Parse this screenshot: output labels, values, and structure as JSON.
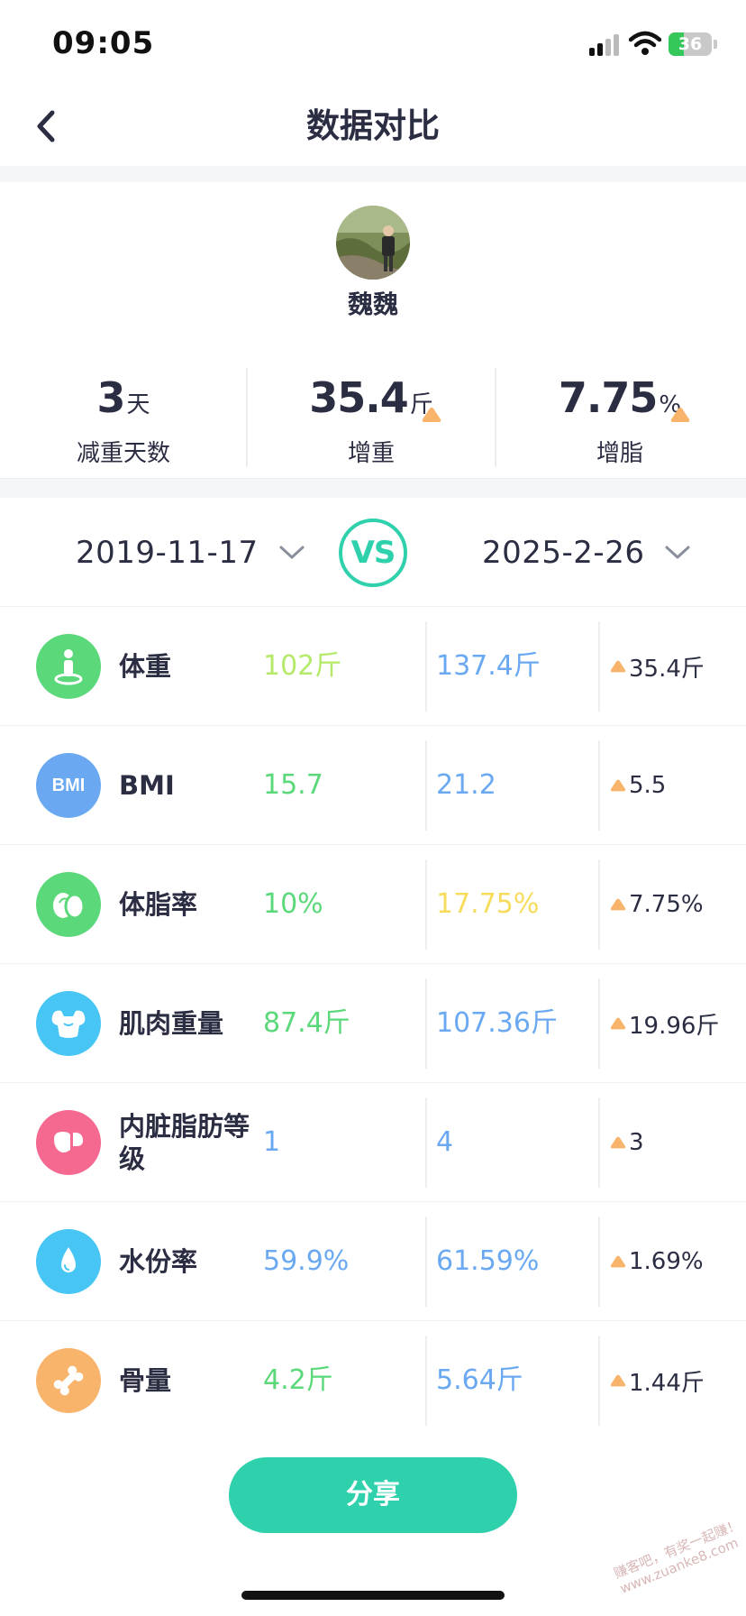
{
  "status_bar": {
    "time": "09:05",
    "battery": "36",
    "battery_level": 0.36
  },
  "nav": {
    "title": "数据对比"
  },
  "user": {
    "name": "魏魏"
  },
  "stats": [
    {
      "value": "3",
      "unit": "天",
      "label": "减重天数",
      "trend": ""
    },
    {
      "value": "35.4",
      "unit": "斤",
      "label": "增重",
      "trend": "up"
    },
    {
      "value": "7.75",
      "unit": "%",
      "label": "增脂",
      "trend": "up"
    }
  ],
  "compare": {
    "date_left": "2019-11-17",
    "vs_label": "VS",
    "date_right": "2025-2-26"
  },
  "metrics": [
    {
      "label": "体重",
      "icon": "body-weight-icon",
      "icon_color": "#5bd87a",
      "v1": "102斤",
      "v1_color": "#b5e96a",
      "v2": "137.4斤",
      "v2_color": "#6aa9f2",
      "diff": "35.4斤"
    },
    {
      "label": "BMI",
      "icon": "bmi-icon",
      "icon_text": "BMI",
      "icon_color": "#6aa9f2",
      "v1": "15.7",
      "v1_color": "#5bd87a",
      "v2": "21.2",
      "v2_color": "#6aa9f2",
      "diff": "5.5"
    },
    {
      "label": "体脂率",
      "icon": "body-fat-icon",
      "icon_color": "#5bd87a",
      "v1": "10%",
      "v1_color": "#5bd87a",
      "v2": "17.75%",
      "v2_color": "#f7dc5c",
      "diff": "7.75%"
    },
    {
      "label": "肌肉重量",
      "icon": "muscle-icon",
      "icon_color": "#47c6f5",
      "v1": "87.4斤",
      "v1_color": "#5bd87a",
      "v2": "107.36斤",
      "v2_color": "#6aa9f2",
      "diff": "19.96斤"
    },
    {
      "label": "内脏脂肪等级",
      "icon": "visceral-fat-icon",
      "icon_color": "#f5688f",
      "v1": "1",
      "v1_color": "#6aa9f2",
      "v2": "4",
      "v2_color": "#6aa9f2",
      "diff": "3"
    },
    {
      "label": "水份率",
      "icon": "water-drop-icon",
      "icon_color": "#47c6f5",
      "v1": "59.9%",
      "v1_color": "#6aa9f2",
      "v2": "61.59%",
      "v2_color": "#6aa9f2",
      "diff": "1.69%"
    },
    {
      "label": "骨量",
      "icon": "bone-icon",
      "icon_color": "#f8b46a",
      "v1": "4.2斤",
      "v1_color": "#5bd87a",
      "v2": "5.64斤",
      "v2_color": "#6aa9f2",
      "diff": "1.44斤"
    }
  ],
  "share_label": "分享",
  "watermark": [
    "赚客吧，有奖一起赚！",
    "www.zuanke8.com"
  ],
  "colors": {
    "accent": "#2fd1ad",
    "up_arrow": "#f8b46a",
    "text": "#2b2d42"
  }
}
